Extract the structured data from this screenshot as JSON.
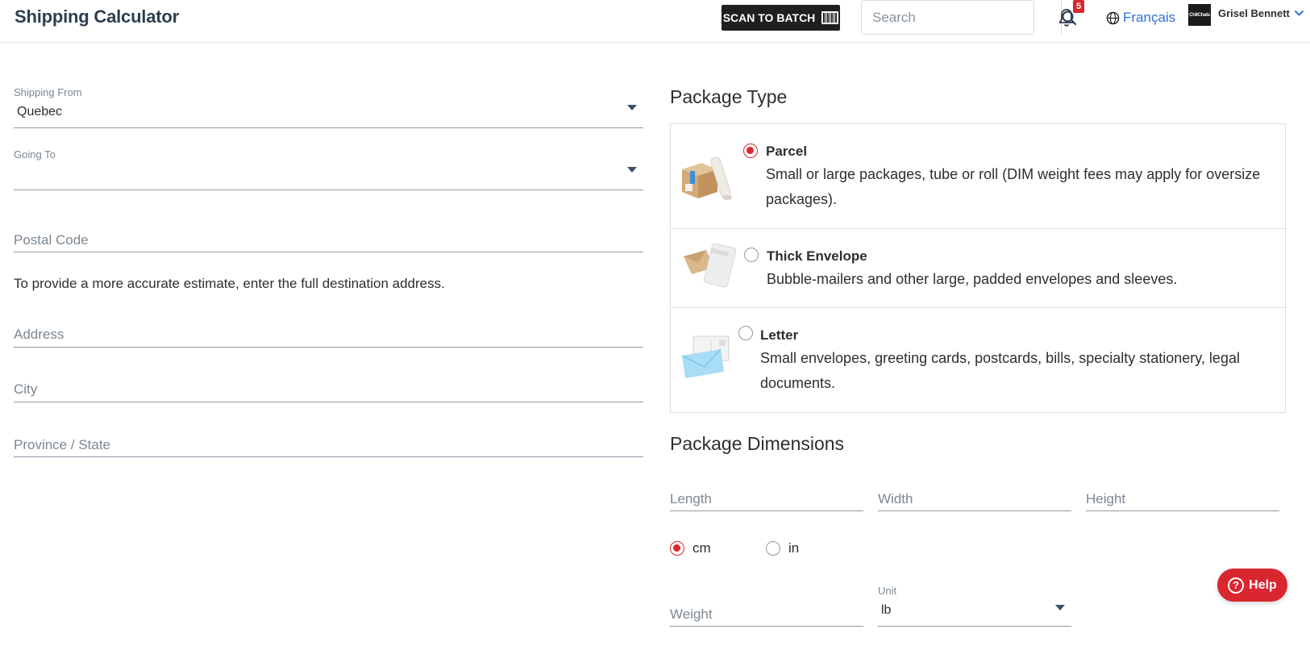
{
  "header": {
    "title": "Shipping Calculator",
    "scan_label": "SCAN TO BATCH",
    "search_placeholder": "Search",
    "notification_count": "5",
    "language": "Français",
    "avatar_text": "ChitChats",
    "user_name": "Grisel Bennett"
  },
  "form": {
    "shipping_from_label": "Shipping From",
    "shipping_from_value": "Quebec",
    "going_to_label": "Going To",
    "going_to_value": "",
    "postal_code_placeholder": "Postal Code",
    "hint": "To provide a more accurate estimate, enter the full destination address.",
    "address_placeholder": "Address",
    "city_placeholder": "City",
    "province_placeholder": "Province / State"
  },
  "package_type": {
    "title": "Package Type",
    "selected": "parcel",
    "options": [
      {
        "id": "parcel",
        "title": "Parcel",
        "description": "Small or large packages, tube or roll (DIM weight fees may apply for oversize packages).",
        "icon": "parcel-box-icon"
      },
      {
        "id": "thick-envelope",
        "title": "Thick Envelope",
        "description": "Bubble-mailers and other large, padded envelopes and sleeves.",
        "icon": "padded-envelope-icon"
      },
      {
        "id": "letter",
        "title": "Letter",
        "description": "Small envelopes, greeting cards, postcards, bills, specialty stationery, legal documents.",
        "icon": "letter-envelope-icon"
      }
    ]
  },
  "dimensions": {
    "title": "Package Dimensions",
    "length_placeholder": "Length",
    "width_placeholder": "Width",
    "height_placeholder": "Height",
    "unit_cm": "cm",
    "unit_in": "in",
    "selected_unit": "cm",
    "weight_placeholder": "Weight",
    "weight_unit_label": "Unit",
    "weight_unit_value": "lb"
  },
  "help": {
    "label": "Help"
  },
  "colors": {
    "accent": "#d9262f",
    "title": "#2d3e50",
    "link": "#2f6fd6"
  }
}
